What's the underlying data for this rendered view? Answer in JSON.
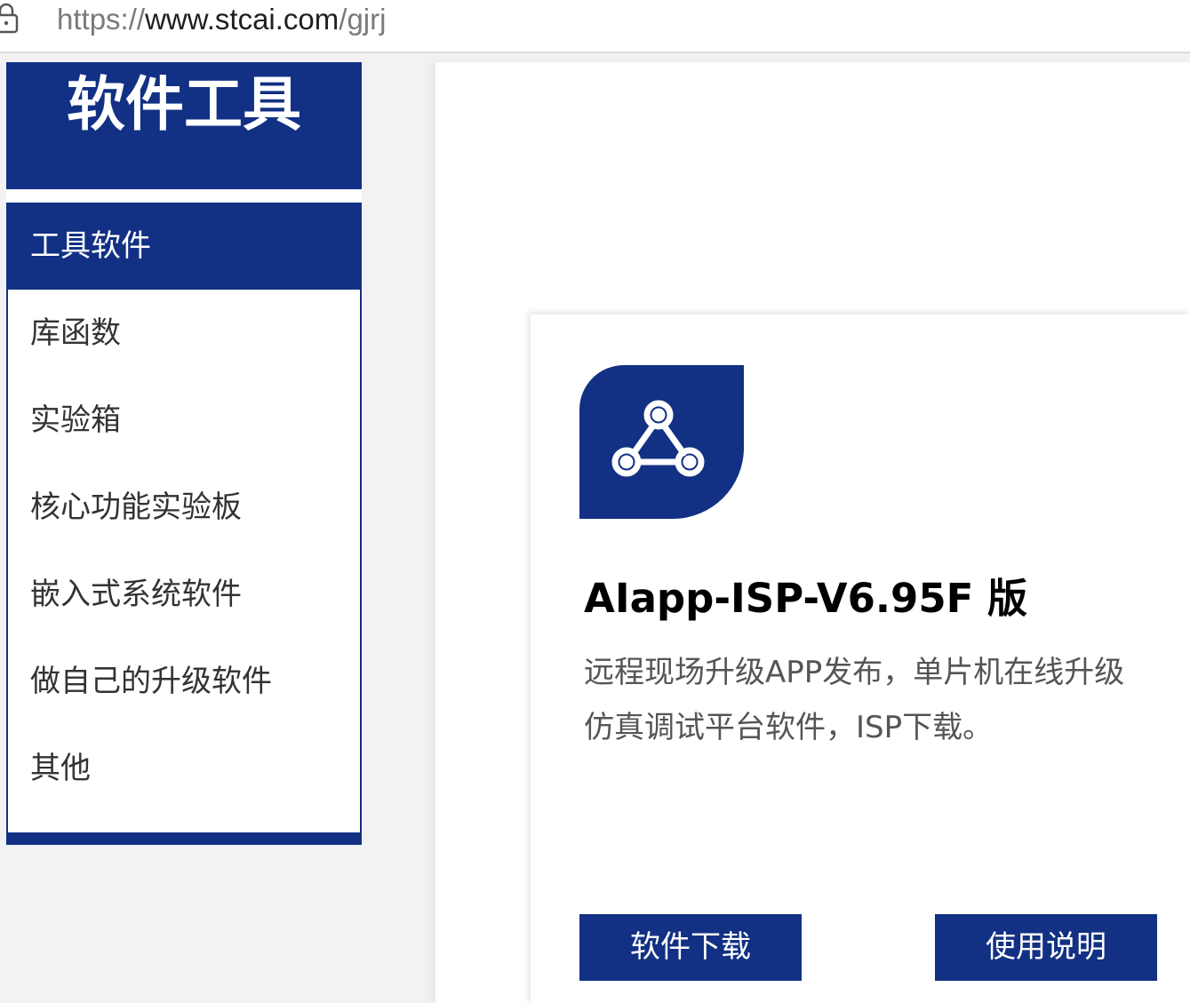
{
  "address_bar": {
    "scheme": "https://",
    "host": "www.stcai.com",
    "path": "/gjrj"
  },
  "sidebar": {
    "title": "软件工具",
    "items": [
      {
        "label": "工具软件",
        "active": true
      },
      {
        "label": "库函数",
        "active": false
      },
      {
        "label": "实验箱",
        "active": false
      },
      {
        "label": "核心功能实验板",
        "active": false
      },
      {
        "label": "嵌入式系统软件",
        "active": false
      },
      {
        "label": "做自己的升级软件",
        "active": false
      },
      {
        "label": "其他",
        "active": false
      }
    ]
  },
  "card": {
    "icon": "share-network-icon",
    "title": "AIapp-ISP-V6.95F 版",
    "desc_lines": [
      "远程现场升级APP发布，单片机在线升级",
      "仿真调试平台软件，ISP下载。"
    ],
    "download_label": "软件下载",
    "manual_label": "使用说明"
  },
  "colors": {
    "brand": "#123184",
    "text": "#333333",
    "muted": "#555555"
  }
}
